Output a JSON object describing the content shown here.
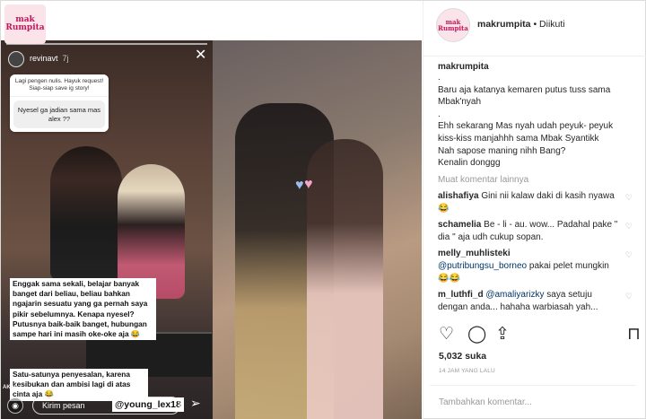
{
  "brand": {
    "logo_text_line1": "mak",
    "logo_text_line2": "Rumpita",
    "accent": "#c2185b"
  },
  "story": {
    "username": "revinavt",
    "time": "7j",
    "question_header": "Lagi pengen nulis. Hayuk request! Siap-siap save ig story!",
    "question_answer": "Nyesel ga jadian sama mas alex ??",
    "caption_1": "Enggak sama sekali, belajar banyak banget dari beliau, beliau bahkan ngajarin sesuatu yang ga pernah saya pikir sebelumnya. Kenapa nyesel? Putusnya baik-baik banget, hubungan sampe hari ini masih oke-oke aja 😂",
    "caption_2": "Satu-satunya penyesalan, karena kesibukan dan ambisi lagi di atas cinta aja 😂",
    "tag": "@young_lex18",
    "brand_mark": "AKAI",
    "message_placeholder": "Kirim pesan"
  },
  "header": {
    "username": "makrumpita",
    "follow_status": "• Diikuti"
  },
  "post": {
    "username": "makrumpita",
    "caption_lines": [
      ".",
      "Baru aja katanya kemaren putus tuss sama Mbak'nyah",
      ".",
      "Ehh sekarang Mas nyah udah peyuk- peyuk kiss-kiss manjahhh sama Mbak Syantikk",
      "Nah sapose maning nihh Bang?",
      "Kenalin donggg"
    ],
    "load_more": "Muat komentar lainnya"
  },
  "comments": [
    {
      "user": "alishafiya",
      "mention": "",
      "text": "Gini nii kalaw daki di kasih nyawa😂"
    },
    {
      "user": "schamelia",
      "mention": "",
      "text": "Be - li - au. wow... Padahal pake \" dia \" aja udh cukup sopan."
    },
    {
      "user": "melly_muhlisteki",
      "mention": "@putribungsu_borneo",
      "text": "pakai pelet mungkin 😂😂"
    },
    {
      "user": "m_luthfi_d",
      "mention": "@amaliyarizky",
      "text": "saya setuju dengan anda... hahaha warbiasah yah..."
    }
  ],
  "icons": {
    "like": "heart-icon",
    "comment": "comment-icon",
    "share": "share-icon",
    "save": "bookmark-icon"
  },
  "likes": "5,032 suka",
  "timestamp": "14 JAM YANG LALU",
  "add_comment_placeholder": "Tambahkan komentar..."
}
